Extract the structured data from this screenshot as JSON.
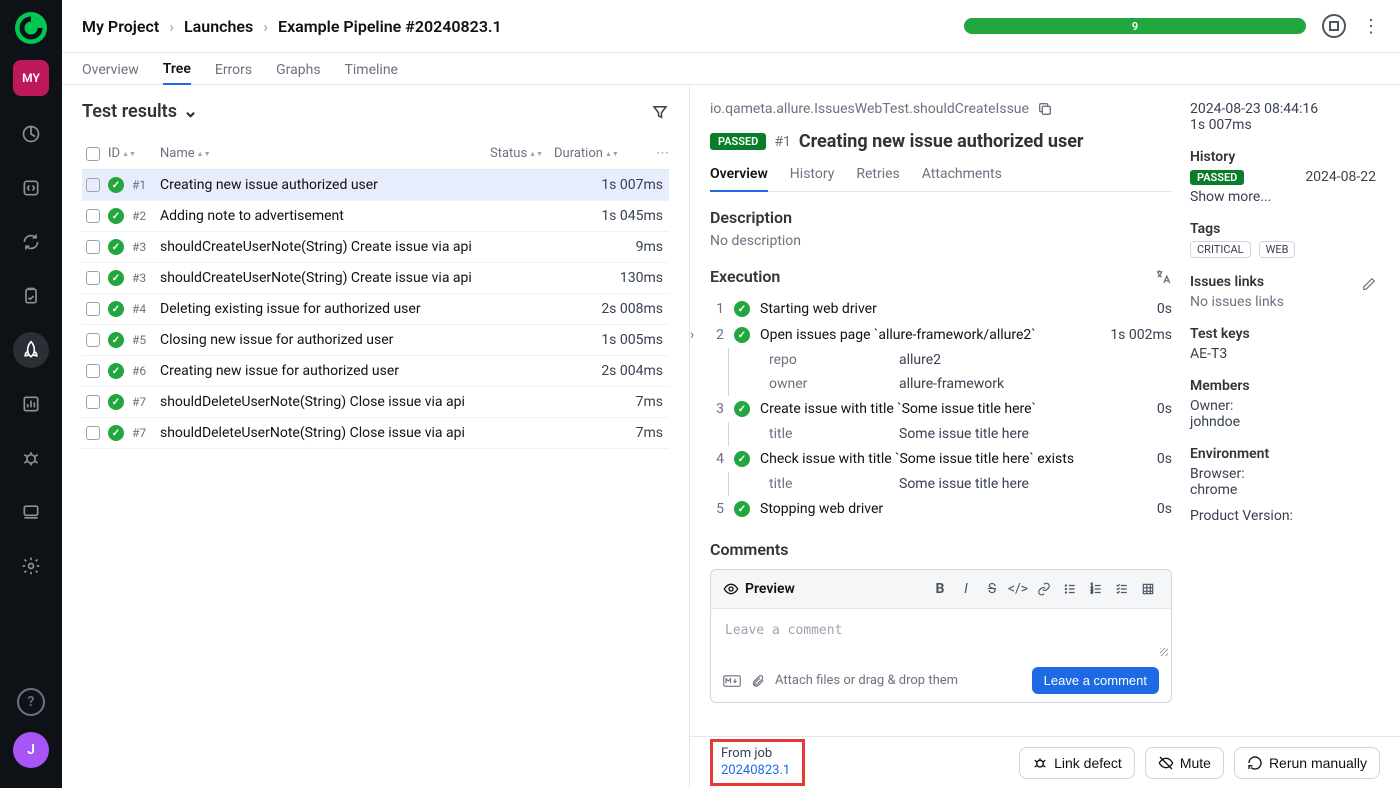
{
  "sidebar": {
    "avatar_label": "MY",
    "user_initial": "J"
  },
  "breadcrumbs": {
    "project": "My Project",
    "section": "Launches",
    "pipeline": "Example Pipeline #20240823.1"
  },
  "progress": {
    "value": "9"
  },
  "main_tabs": {
    "overview": "Overview",
    "tree": "Tree",
    "errors": "Errors",
    "graphs": "Graphs",
    "timeline": "Timeline"
  },
  "results": {
    "title": "Test results",
    "columns": {
      "id": "ID",
      "name": "Name",
      "status": "Status",
      "duration": "Duration"
    },
    "rows": [
      {
        "id": "#1",
        "name": "Creating new issue authorized user",
        "duration": "1s 007ms"
      },
      {
        "id": "#2",
        "name": "Adding note to advertisement",
        "duration": "1s 045ms"
      },
      {
        "id": "#3",
        "name": "shouldCreateUserNote(String) Create issue via api",
        "duration": "9ms"
      },
      {
        "id": "#3",
        "name": "shouldCreateUserNote(String) Create issue via api",
        "duration": "130ms"
      },
      {
        "id": "#4",
        "name": "Deleting existing issue for authorized user",
        "duration": "2s 008ms"
      },
      {
        "id": "#5",
        "name": "Closing new issue for authorized user",
        "duration": "1s 005ms"
      },
      {
        "id": "#6",
        "name": "Creating new issue for authorized user",
        "duration": "2s 004ms"
      },
      {
        "id": "#7",
        "name": "shouldDeleteUserNote(String) Close issue via api",
        "duration": "7ms"
      },
      {
        "id": "#7",
        "name": "shouldDeleteUserNote(String) Close issue via api",
        "duration": "7ms"
      }
    ]
  },
  "detail": {
    "path": "io.qameta.allure.IssuesWebTest.shouldCreateIssue",
    "badge": "PASSED",
    "num": "#1",
    "title": "Creating new issue authorized user",
    "tabs": {
      "overview": "Overview",
      "history": "History",
      "retries": "Retries",
      "attachments": "Attachments"
    },
    "description_label": "Description",
    "description_text": "No description",
    "execution_label": "Execution",
    "steps": [
      {
        "n": "1",
        "name": "Starting web driver",
        "dur": "0s"
      },
      {
        "n": "2",
        "name": "Open issues page `allure-framework/allure2`",
        "dur": "1s 002ms",
        "expandable": true,
        "params": [
          {
            "k": "repo",
            "v": "allure2"
          },
          {
            "k": "owner",
            "v": "allure-framework"
          }
        ]
      },
      {
        "n": "3",
        "name": "Create issue with title `Some issue title here`",
        "dur": "0s",
        "params": [
          {
            "k": "title",
            "v": "Some issue title here"
          }
        ]
      },
      {
        "n": "4",
        "name": "Check issue with title `Some issue title here` exists",
        "dur": "0s",
        "params": [
          {
            "k": "title",
            "v": "Some issue title here"
          }
        ]
      },
      {
        "n": "5",
        "name": "Stopping web driver",
        "dur": "0s"
      }
    ],
    "comments_label": "Comments",
    "preview": "Preview",
    "comment_placeholder": "Leave a comment",
    "attach_hint": "Attach files or drag & drop them",
    "leave_comment_btn": "Leave a comment"
  },
  "side": {
    "timestamp": "2024-08-23 08:44:16",
    "duration": "1s 007ms",
    "history_label": "History",
    "history_badge": "PASSED",
    "history_date": "2024-08-22",
    "show_more": "Show more...",
    "tags_label": "Tags",
    "tags": [
      "CRITICAL",
      "WEB"
    ],
    "issues_label": "Issues links",
    "issues_text": "No issues links",
    "testkeys_label": "Test keys",
    "testkeys_value": "AE-T3",
    "members_label": "Members",
    "members_owner_label": "Owner:",
    "members_owner": "johndoe",
    "env_label": "Environment",
    "env_browser_label": "Browser:",
    "env_browser": "chrome",
    "env_product_label": "Product Version:"
  },
  "bottom": {
    "from_job_label": "From job",
    "from_job_link": "20240823.1",
    "link_defect": "Link defect",
    "mute": "Mute",
    "rerun": "Rerun manually"
  }
}
